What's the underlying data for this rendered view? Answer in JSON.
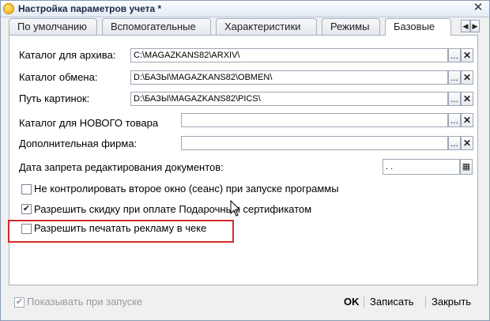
{
  "window": {
    "title": "Настройка параметров учета *",
    "close": "✕"
  },
  "tabs": [
    {
      "label": "По умолчанию",
      "active": false
    },
    {
      "label": "Вспомогательные",
      "active": false
    },
    {
      "label": "Характеристики",
      "active": false
    },
    {
      "label": "Режимы",
      "active": false
    },
    {
      "label": "Базовые",
      "active": true
    }
  ],
  "tab_scroll": {
    "left": "◀",
    "right": "▶"
  },
  "fields": {
    "archive": {
      "label": "Каталог для архива:",
      "value": "C:\\MAGAZKANS82\\ARXIV\\"
    },
    "exchange": {
      "label": "Каталог обмена:",
      "value": "D:\\БАЗЫ\\MAGAZKANS82\\OBMEN\\"
    },
    "pictures": {
      "label": "Путь картинок:",
      "value": "D:\\БАЗЫ\\MAGAZKANS82\\PICS\\"
    },
    "new_goods": {
      "label": "Каталог для НОВОГО товара",
      "value": ""
    },
    "extra_firm": {
      "label": "Дополнительная фирма:",
      "value": ""
    },
    "edit_ban_date": {
      "label": "Дата запрета редактирования документов:",
      "value": " .  ."
    }
  },
  "field_buttons": {
    "select": "...",
    "clear": "✕"
  },
  "checkboxes": {
    "second_window": {
      "label": "Не контролировать второе окно (сеанс) при запуске программы",
      "checked": false
    },
    "gift_discount": {
      "label": "Разрешить скидку при оплате Подарочным сертификатом",
      "checked": true
    },
    "print_ads": {
      "label": "Разрешить печатать рекламу в чеке",
      "checked": false
    }
  },
  "footer": {
    "show_on_start": {
      "label": "Показывать при запуске",
      "checked": true
    },
    "ok_label": "OK",
    "save_label": "Записать",
    "close_label": "Закрыть"
  },
  "colors": {
    "highlight_border": "#d42a2a",
    "disabled_text": "#9a9a9a"
  }
}
